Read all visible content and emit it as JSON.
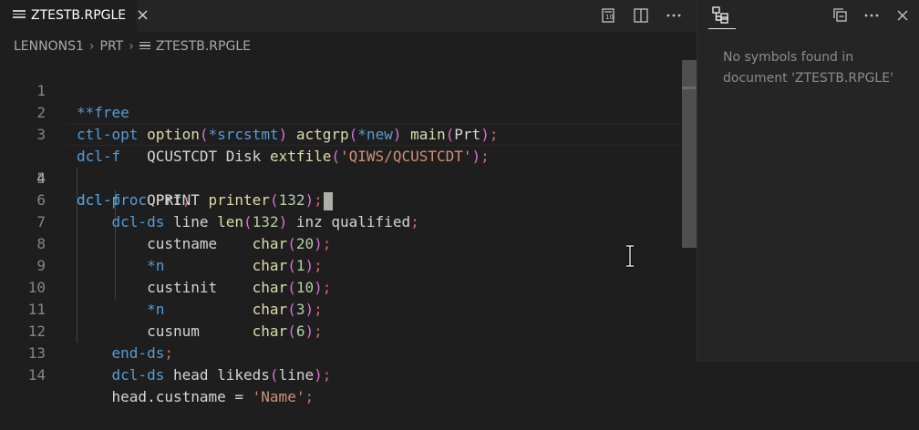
{
  "tab": {
    "label": "ZTESTB.RPGLE",
    "close": "×"
  },
  "tab_actions": [
    "open-preview-icon",
    "split-editor-icon",
    "more-actions-icon"
  ],
  "breadcrumb": {
    "items": [
      "LENNONS1",
      "PRT",
      "ZTESTB.RPGLE"
    ],
    "separator": "›"
  },
  "code": {
    "active_line": 4,
    "line_numbers": [
      "1",
      "2",
      "3",
      "4",
      "5",
      "6",
      "7",
      "8",
      "9",
      "10",
      "11",
      "12",
      "13",
      "14"
    ]
  },
  "outline": {
    "icon": "outline-icon",
    "actions": [
      "collapse-all-icon",
      "more-actions-icon",
      "close-icon"
    ],
    "message": "No symbols found in document 'ZTESTB.RPGLE'"
  },
  "colors": {
    "keyword": "#569cd6",
    "function": "#dcdcaa",
    "string": "#ce9178",
    "number": "#b5cea8",
    "paren": "#da70d6",
    "semicolon": "#d16969"
  }
}
